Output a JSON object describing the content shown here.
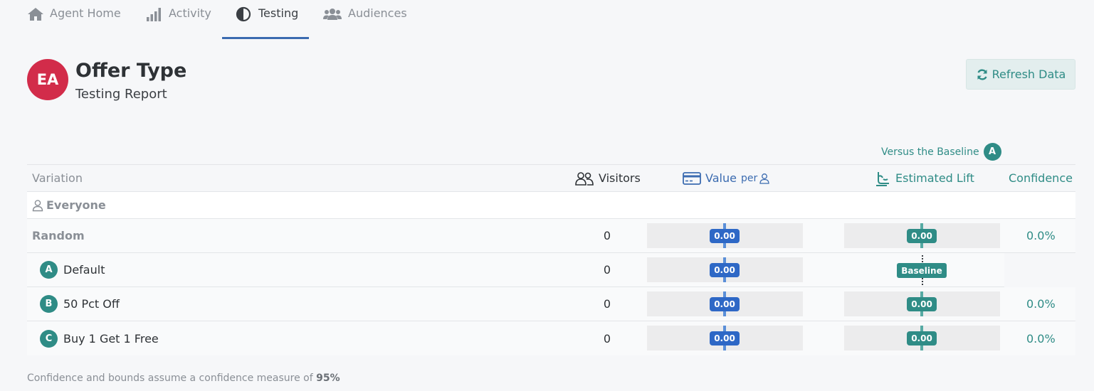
{
  "nav": {
    "tabs": [
      {
        "label": "Agent Home",
        "icon": "home-icon"
      },
      {
        "label": "Activity",
        "icon": "bar-chart-icon"
      },
      {
        "label": "Testing",
        "icon": "half-circle-icon",
        "active": true
      },
      {
        "label": "Audiences",
        "icon": "users-icon"
      }
    ]
  },
  "header": {
    "avatar_initials": "EA",
    "avatar_color": "#d22c4a",
    "title": "Offer Type",
    "subtitle": "Testing Report",
    "refresh_label": "Refresh Data"
  },
  "versus": {
    "label": "Versus the Baseline",
    "badge": "A"
  },
  "table": {
    "headers": {
      "variation": "Variation",
      "visitors": "Visitors",
      "value": "Value",
      "value_per": "per",
      "lift": "Estimated Lift",
      "confidence": "Confidence"
    },
    "segment": "Everyone",
    "rows": [
      {
        "badge": "",
        "name": "Random",
        "visitors": "0",
        "value": "0.00",
        "lift": "0.00",
        "confidence": "0.0%"
      },
      {
        "badge": "A",
        "name": "Default",
        "visitors": "0",
        "value": "0.00",
        "lift": "Baseline",
        "confidence": ""
      },
      {
        "badge": "B",
        "name": "50 Pct Off",
        "visitors": "0",
        "value": "0.00",
        "lift": "0.00",
        "confidence": "0.0%"
      },
      {
        "badge": "C",
        "name": "Buy 1 Get 1 Free",
        "visitors": "0",
        "value": "0.00",
        "lift": "0.00",
        "confidence": "0.0%"
      }
    ]
  },
  "footnote": {
    "text": "Confidence and bounds assume a confidence measure of",
    "value": "95%"
  },
  "colors": {
    "accent_teal": "#2f8c86",
    "accent_blue": "#2e68c6",
    "nav_active_underline": "#3b6bb0"
  }
}
